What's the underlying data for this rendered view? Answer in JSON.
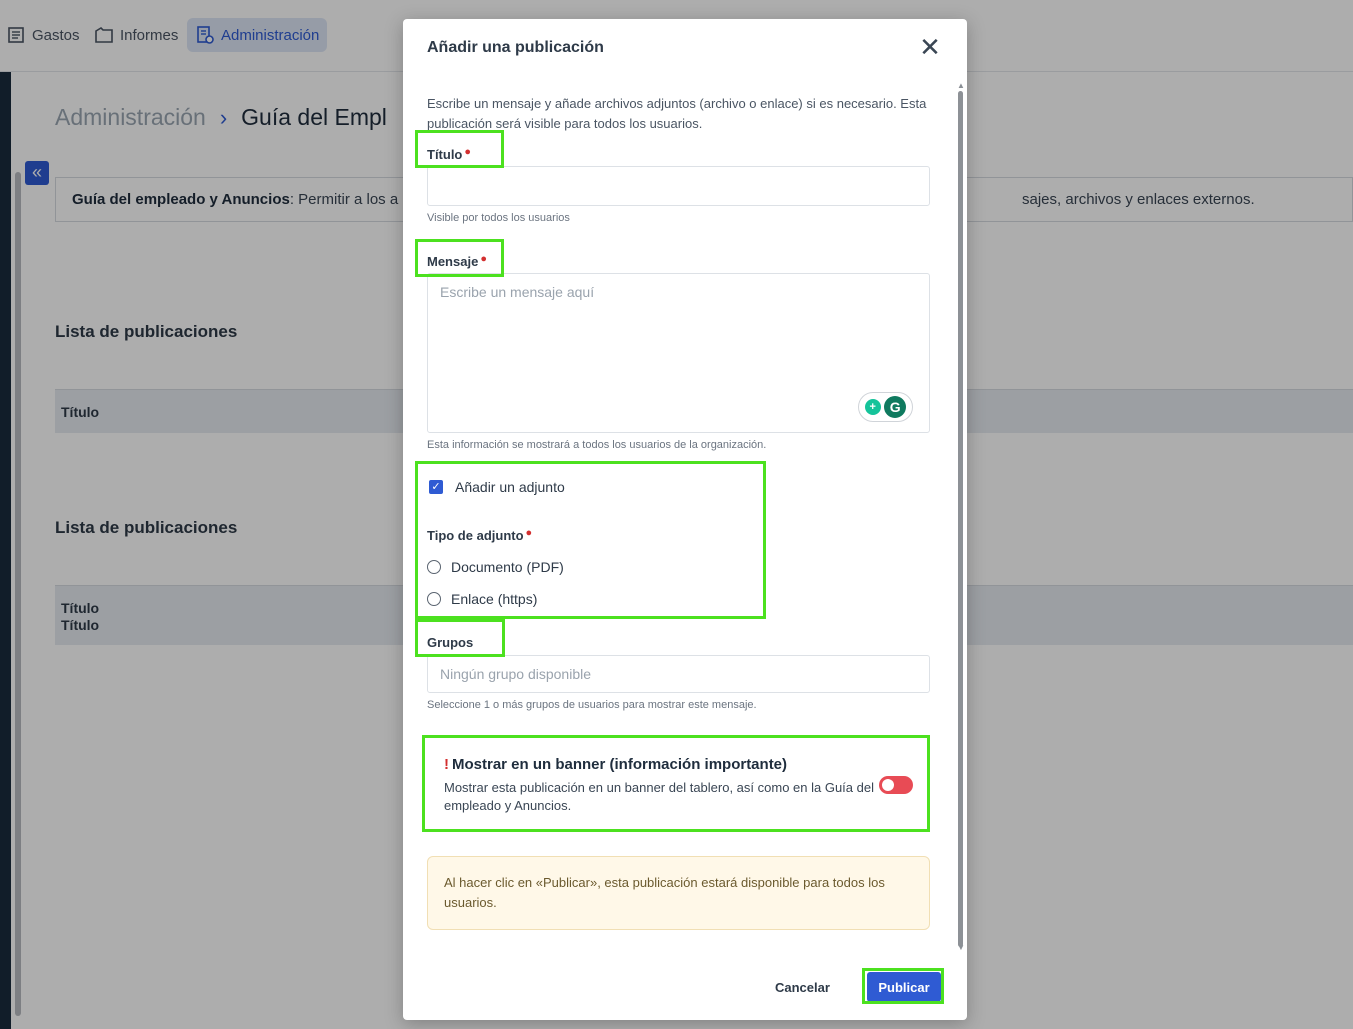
{
  "nav": {
    "items": [
      {
        "label": "Gastos",
        "icon": "receipt-icon"
      },
      {
        "label": "Informes",
        "icon": "folder-icon"
      },
      {
        "label": "Administración",
        "icon": "admin-icon"
      }
    ]
  },
  "breadcrumb": {
    "root": "Administración",
    "separator": "›",
    "current": "Guía del Empl"
  },
  "info": {
    "bold": "Guía del empleado y Anuncios",
    "text": ": Permitir a los a",
    "tail": "sajes, archivos y enlaces externos."
  },
  "lists": [
    {
      "title": "Lista de publicaciones",
      "header": "Título"
    },
    {
      "title": "Lista de publicaciones",
      "header_lines": [
        "Título",
        "Título"
      ]
    }
  ],
  "modal": {
    "title": "Añadir una publicación",
    "intro": "Escribe un mensaje y añade archivos adjuntos (archivo o enlace) si es necesario. Esta publicación será visible para todos los usuarios.",
    "title_field": {
      "label": "Título",
      "value": "",
      "hint": "Visible por todos los usuarios"
    },
    "message_field": {
      "label": "Mensaje",
      "placeholder": "Escribe un mensaje aquí",
      "hint": "Esta información se mostrará a todos los usuarios de la organización."
    },
    "attachment": {
      "label": "Añadir un adjunto",
      "checked": true
    },
    "attachment_type": {
      "label": "Tipo de adjunto",
      "options": [
        "Documento (PDF)",
        "Enlace (https)"
      ]
    },
    "groups": {
      "label": "Grupos",
      "placeholder": "Ningún grupo disponible",
      "hint": "Seleccione 1 o más grupos de usuarios para mostrar este mensaje."
    },
    "banner": {
      "title": "Mostrar en un banner (información importante)",
      "description": "Mostrar esta publicación en un banner del tablero, así como en la Guía del empleado y Anuncios.",
      "enabled": false,
      "toggle_color": "#e84b55"
    },
    "warning": "Al hacer clic en «Publicar», esta publicación estará disponible para todos los usuarios.",
    "cancel_label": "Cancelar",
    "publish_label": "Publicar"
  },
  "colors": {
    "accent": "#2f5bd3",
    "highlight": "#4ce11f",
    "required": "#d32f2f"
  }
}
